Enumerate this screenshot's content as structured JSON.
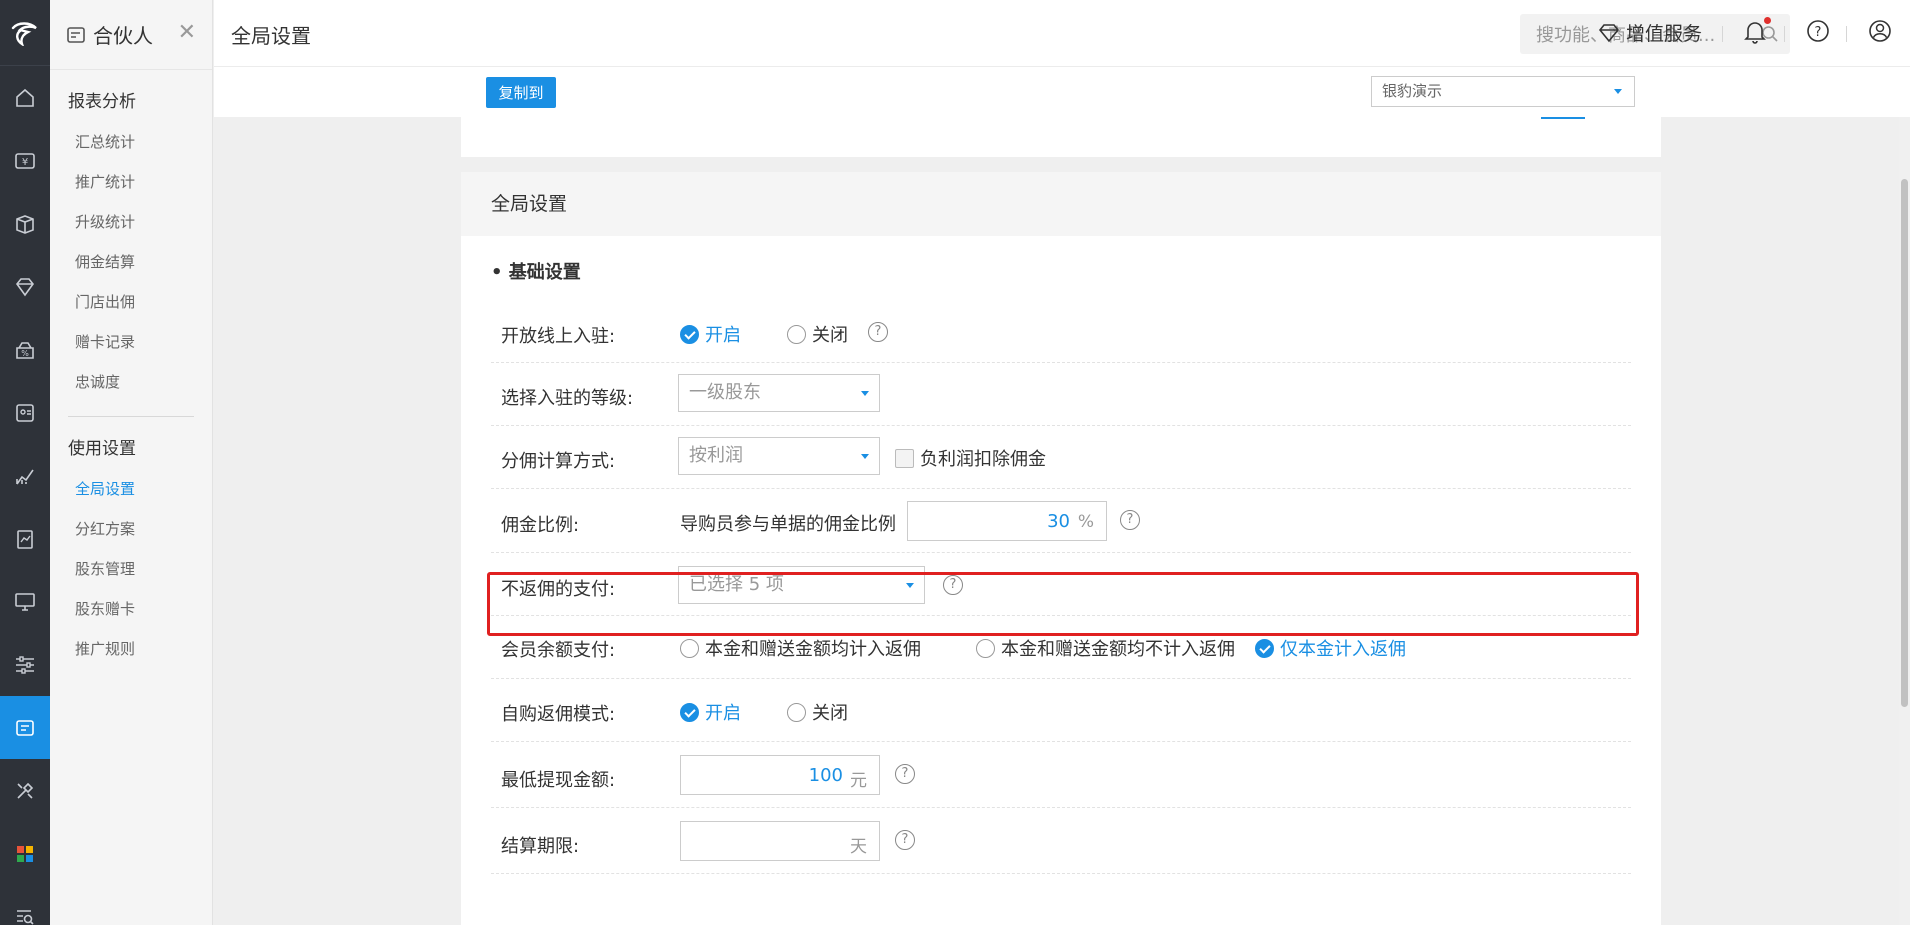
{
  "header": {
    "page_title": "全局设置",
    "search_placeholder": "搜功能、商品、会员...",
    "value_service_label": "增值服务"
  },
  "menu": {
    "app_title": "合伙人",
    "groups": [
      {
        "title": "报表分析",
        "items": [
          "汇总统计",
          "推广统计",
          "升级统计",
          "佣金结算",
          "门店出佣",
          "赠卡记录",
          "忠诚度"
        ]
      },
      {
        "title": "使用设置",
        "items": [
          "全局设置",
          "分红方案",
          "股东管理",
          "股东赠卡",
          "推广规则"
        ]
      }
    ],
    "active_item": "全局设置"
  },
  "rail_icons": [
    "home-icon",
    "yuan-card-icon",
    "box-icon",
    "gem-icon",
    "discount-icon",
    "member-card-icon",
    "chart-icon",
    "report-icon",
    "monitor-icon",
    "sliders-icon",
    "partner-icon",
    "tools-icon",
    "apps-icon",
    "search-list-icon"
  ],
  "toolbar": {
    "copy_button": "复制到",
    "store_select": "银豹演示"
  },
  "panel": {
    "title": "全局设置",
    "section_title": "• 基础设置",
    "rows": {
      "open_entry": {
        "label": "开放线上入驻:",
        "on": "开启",
        "off": "关闭",
        "selected": "开启"
      },
      "entry_level": {
        "label": "选择入驻的等级:",
        "value": "一级股东"
      },
      "commission_calc": {
        "label": "分佣计算方式:",
        "value": "按利润",
        "checkbox_label": "负利润扣除佣金",
        "checkbox_checked": false
      },
      "commission_ratio": {
        "label": "佣金比例:",
        "desc": "导购员参与单据的佣金比例",
        "value": "30",
        "unit": "%"
      },
      "no_commission_pay": {
        "label": "不返佣的支付:",
        "value": "已选择 5 项"
      },
      "member_balance_pay": {
        "label": "会员余额支付:",
        "options": [
          "本金和赠送金额均计入返佣",
          "本金和赠送金额均不计入返佣",
          "仅本金计入返佣"
        ],
        "selected": "仅本金计入返佣"
      },
      "self_purchase": {
        "label": "自购返佣模式:",
        "on": "开启",
        "off": "关闭",
        "selected": "开启"
      },
      "min_withdraw": {
        "label": "最低提现金额:",
        "value": "100",
        "unit": "元"
      },
      "settle_period": {
        "label": "结算期限:",
        "value": "",
        "unit": "天"
      }
    }
  },
  "colors": {
    "accent": "#1a8fe3",
    "highlight_border": "#e02020",
    "rail_bg": "#2e3239"
  }
}
